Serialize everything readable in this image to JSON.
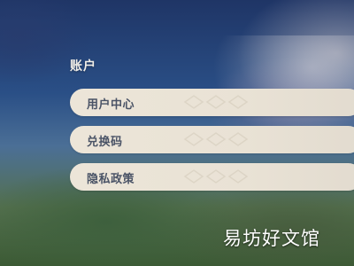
{
  "section": {
    "title": "账户"
  },
  "menu": {
    "items": [
      {
        "label": "用户中心"
      },
      {
        "label": "兑换码"
      },
      {
        "label": "隐私政策"
      }
    ]
  },
  "watermark": {
    "text": "易坊好文馆"
  },
  "colors": {
    "item_background": "#ece5d8",
    "item_text": "#4a5366",
    "title_text": "#f2efe9"
  }
}
